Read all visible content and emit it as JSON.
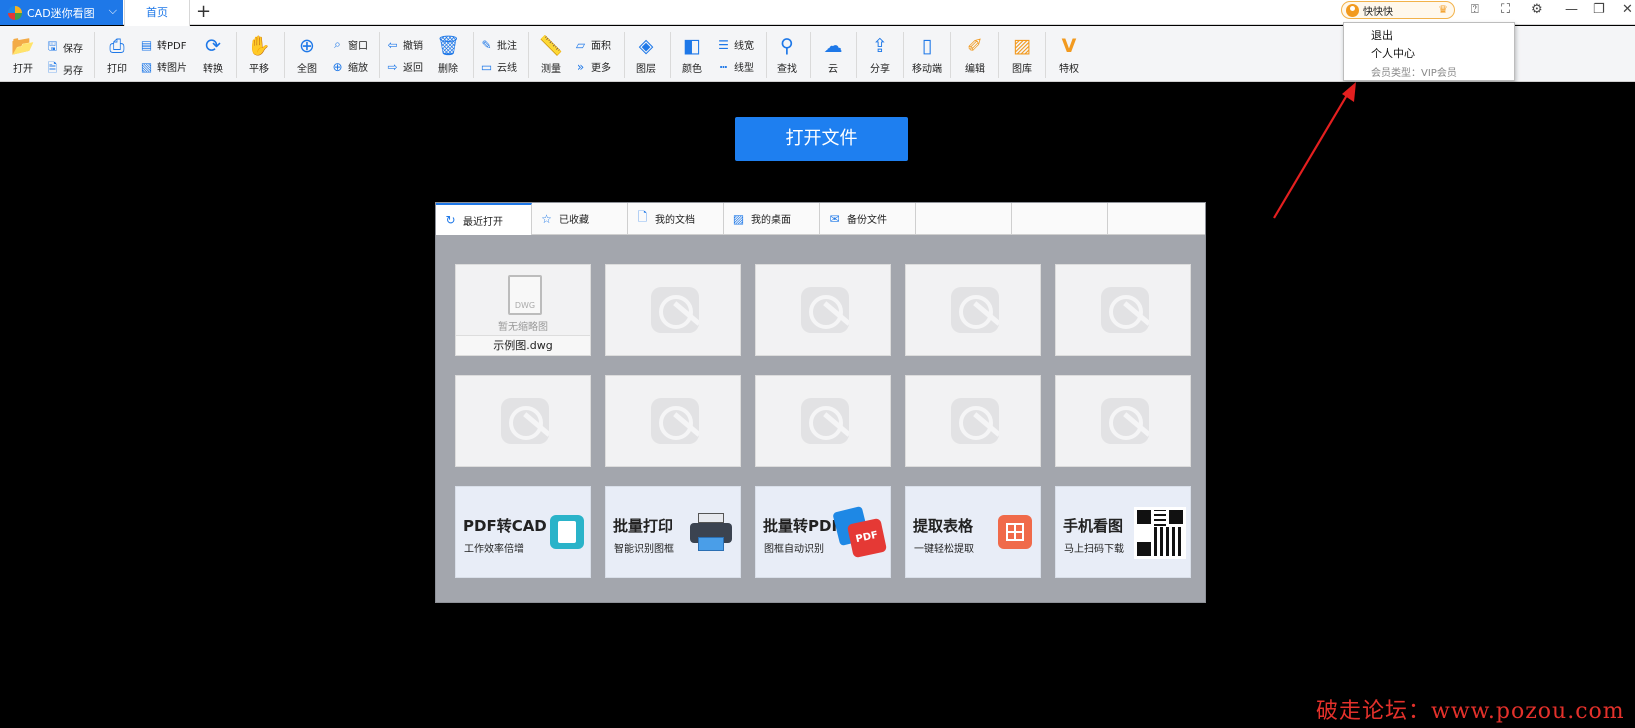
{
  "app": {
    "name": "CAD迷你看图",
    "home_tab": "首页",
    "new_tab": "+"
  },
  "user": {
    "name": "快快快",
    "menu": {
      "logout": "退出",
      "profile": "个人中心",
      "member": "会员类型：VIP会员"
    }
  },
  "ribbon": {
    "open": "打开",
    "save": "保存",
    "save_as": "另存",
    "print": "打印",
    "to_pdf": "转PDF",
    "to_image": "转图片",
    "convert": "转换",
    "pan": "平移",
    "full": "全图",
    "window": "窗口",
    "zoom": "缩放",
    "undo": "撤销",
    "back": "返回",
    "delete": "删除",
    "annotate": "批注",
    "cloudline": "云线",
    "measure": "测量",
    "area": "面积",
    "more": "更多",
    "layer": "图层",
    "color": "颜色",
    "linewidth": "线宽",
    "linetype": "线型",
    "find": "查找",
    "cloud": "云",
    "share": "分享",
    "mobile": "移动端",
    "edit": "编辑",
    "gallery": "图库",
    "privilege": "特权"
  },
  "main": {
    "open_file_button": "打开文件"
  },
  "panel": {
    "tabs": [
      "最近打开",
      "已收藏",
      "我的文档",
      "我的桌面",
      "备份文件"
    ],
    "first_file": {
      "no_thumb": "暂无缩略图",
      "name": "示例图.dwg",
      "badge": "DWG"
    },
    "promos": [
      {
        "title": "PDF转CAD",
        "sub": "工作效率倍增"
      },
      {
        "title": "批量打印",
        "sub": "智能识别图框"
      },
      {
        "title": "批量转PDF",
        "sub": "图框自动识别"
      },
      {
        "title": "提取表格",
        "sub": "一键轻松提取"
      },
      {
        "title": "手机看图",
        "sub": "马上扫码下载"
      }
    ]
  },
  "watermark": "破走论坛：www.pozou.com"
}
